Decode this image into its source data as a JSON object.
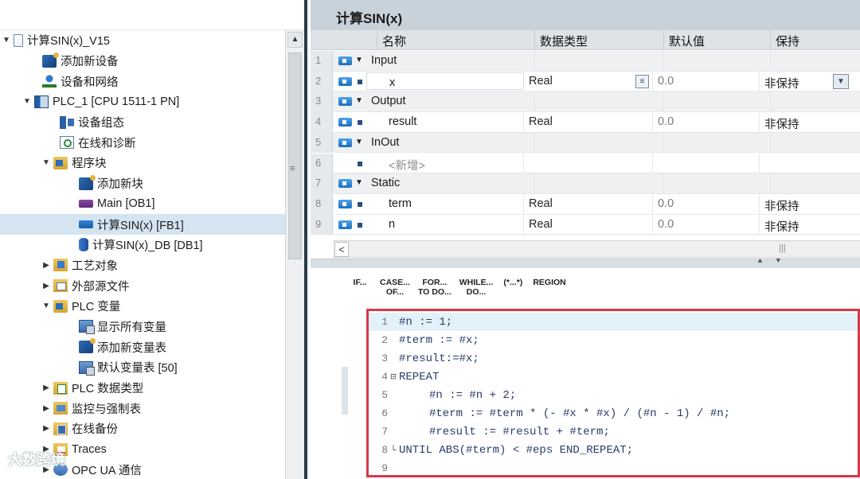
{
  "tree": {
    "items": [
      {
        "label": "计算SIN(x)_V15",
        "indent": 6,
        "arrow": "▼",
        "icon": "doc-icon",
        "cls": "i-doc"
      },
      {
        "label": "添加新设备",
        "indent": 50,
        "arrow": "",
        "icon": "add-device-icon",
        "cls": "i-add"
      },
      {
        "label": "设备和网络",
        "indent": 50,
        "arrow": "",
        "icon": "network-icon",
        "cls": "i-net"
      },
      {
        "label": "PLC_1 [CPU 1511-1 PN]",
        "indent": 32,
        "arrow": "▼",
        "icon": "plc-icon",
        "cls": "i-plc"
      },
      {
        "label": "设备组态",
        "indent": 72,
        "arrow": "",
        "icon": "device-config-icon",
        "cls": "i-cfg"
      },
      {
        "label": "在线和诊断",
        "indent": 72,
        "arrow": "",
        "icon": "diagnostics-icon",
        "cls": "i-diag"
      },
      {
        "label": "程序块",
        "indent": 56,
        "arrow": "▼",
        "icon": "program-blocks-folder-icon",
        "cls": "i-folder"
      },
      {
        "label": "添加新块",
        "indent": 96,
        "arrow": "",
        "icon": "add-block-icon",
        "cls": "i-add"
      },
      {
        "label": "Main [OB1]",
        "indent": 96,
        "arrow": "",
        "icon": "ob-block-icon",
        "cls": "i-ob"
      },
      {
        "label": "计算SIN(x) [FB1]",
        "indent": 96,
        "arrow": "",
        "icon": "fb-block-icon",
        "cls": "i-fb",
        "selected": true
      },
      {
        "label": "计算SIN(x)_DB [DB1]",
        "indent": 96,
        "arrow": "",
        "icon": "db-block-icon",
        "cls": "i-db"
      },
      {
        "label": "工艺对象",
        "indent": 56,
        "arrow": "▶",
        "icon": "technology-objects-icon",
        "cls": "i-tech"
      },
      {
        "label": "外部源文件",
        "indent": 56,
        "arrow": "▶",
        "icon": "external-sources-icon",
        "cls": "i-ext"
      },
      {
        "label": "PLC 变量",
        "indent": 56,
        "arrow": "▼",
        "icon": "plc-tags-folder-icon",
        "cls": "i-folder"
      },
      {
        "label": "显示所有变量",
        "indent": 96,
        "arrow": "",
        "icon": "show-all-tags-icon",
        "cls": "i-tags"
      },
      {
        "label": "添加新变量表",
        "indent": 96,
        "arrow": "",
        "icon": "add-tag-table-icon",
        "cls": "i-add"
      },
      {
        "label": "默认变量表 [50]",
        "indent": 96,
        "arrow": "",
        "icon": "default-tag-table-icon",
        "cls": "i-tags"
      },
      {
        "label": "PLC 数据类型",
        "indent": 56,
        "arrow": "▶",
        "icon": "plc-data-types-icon",
        "cls": "i-types"
      },
      {
        "label": "监控与强制表",
        "indent": 56,
        "arrow": "▶",
        "icon": "watch-force-tables-icon",
        "cls": "i-watch"
      },
      {
        "label": "在线备份",
        "indent": 56,
        "arrow": "▶",
        "icon": "online-backups-icon",
        "cls": "i-backup"
      },
      {
        "label": "Traces",
        "indent": 56,
        "arrow": "▶",
        "icon": "traces-icon",
        "cls": "i-traces"
      },
      {
        "label": "OPC UA 通信",
        "indent": 56,
        "arrow": "▶",
        "icon": "opc-ua-icon",
        "cls": "i-opc"
      }
    ]
  },
  "block": {
    "title": "计算SIN(x)"
  },
  "interface": {
    "headers": {
      "name": "名称",
      "type": "数据类型",
      "default": "默认值",
      "retain": "保持"
    },
    "rows": [
      {
        "num": "1",
        "kind": "section",
        "name": "Input",
        "type": "",
        "default": "",
        "retain": ""
      },
      {
        "num": "2",
        "kind": "var",
        "name": "x",
        "type": "Real",
        "default": "0.0",
        "retain": "非保持",
        "selected": true
      },
      {
        "num": "3",
        "kind": "section",
        "name": "Output",
        "type": "",
        "default": "",
        "retain": ""
      },
      {
        "num": "4",
        "kind": "var",
        "name": "result",
        "type": "Real",
        "default": "0.0",
        "retain": "非保持"
      },
      {
        "num": "5",
        "kind": "section",
        "name": "InOut",
        "type": "",
        "default": "",
        "retain": ""
      },
      {
        "num": "6",
        "kind": "add",
        "name": "<新增>",
        "type": "",
        "default": "",
        "retain": ""
      },
      {
        "num": "7",
        "kind": "section",
        "name": "Static",
        "type": "",
        "default": "",
        "retain": ""
      },
      {
        "num": "8",
        "kind": "var",
        "name": "term",
        "type": "Real",
        "default": "0.0",
        "retain": "非保持"
      },
      {
        "num": "9",
        "kind": "var",
        "name": "n",
        "type": "Real",
        "default": "0.0",
        "retain": "非保持"
      }
    ]
  },
  "toolbar": {
    "buttons": [
      {
        "label": "IF...",
        "name": "if-button"
      },
      {
        "label": "CASE...\nOF...",
        "name": "case-of-button"
      },
      {
        "label": "FOR...\nTO DO...",
        "name": "for-to-do-button"
      },
      {
        "label": "WHILE...\nDO...",
        "name": "while-do-button"
      },
      {
        "label": "(*...*)",
        "name": "comment-button"
      },
      {
        "label": "REGION",
        "name": "region-button"
      }
    ]
  },
  "code": {
    "lines": [
      {
        "num": "1",
        "text": "#n := 1;",
        "indent": 0,
        "fold": ""
      },
      {
        "num": "2",
        "text": "#term := #x;",
        "indent": 0,
        "fold": ""
      },
      {
        "num": "3",
        "text": "#result:=#x;",
        "indent": 0,
        "fold": ""
      },
      {
        "num": "4",
        "text": "REPEAT",
        "indent": 0,
        "fold": "⊟"
      },
      {
        "num": "5",
        "text": "#n := #n + 2;",
        "indent": 1,
        "fold": ""
      },
      {
        "num": "6",
        "text": "#term := #term * (- #x * #x) / (#n - 1) / #n;",
        "indent": 1,
        "fold": ""
      },
      {
        "num": "7",
        "text": "#result := #result + #term;",
        "indent": 1,
        "fold": ""
      },
      {
        "num": "8",
        "text": "UNTIL ABS(#term) < #eps END_REPEAT;",
        "indent": 0,
        "fold": "└"
      },
      {
        "num": "9",
        "text": "",
        "indent": 0,
        "fold": ""
      }
    ]
  },
  "watermark": "大数跨境"
}
